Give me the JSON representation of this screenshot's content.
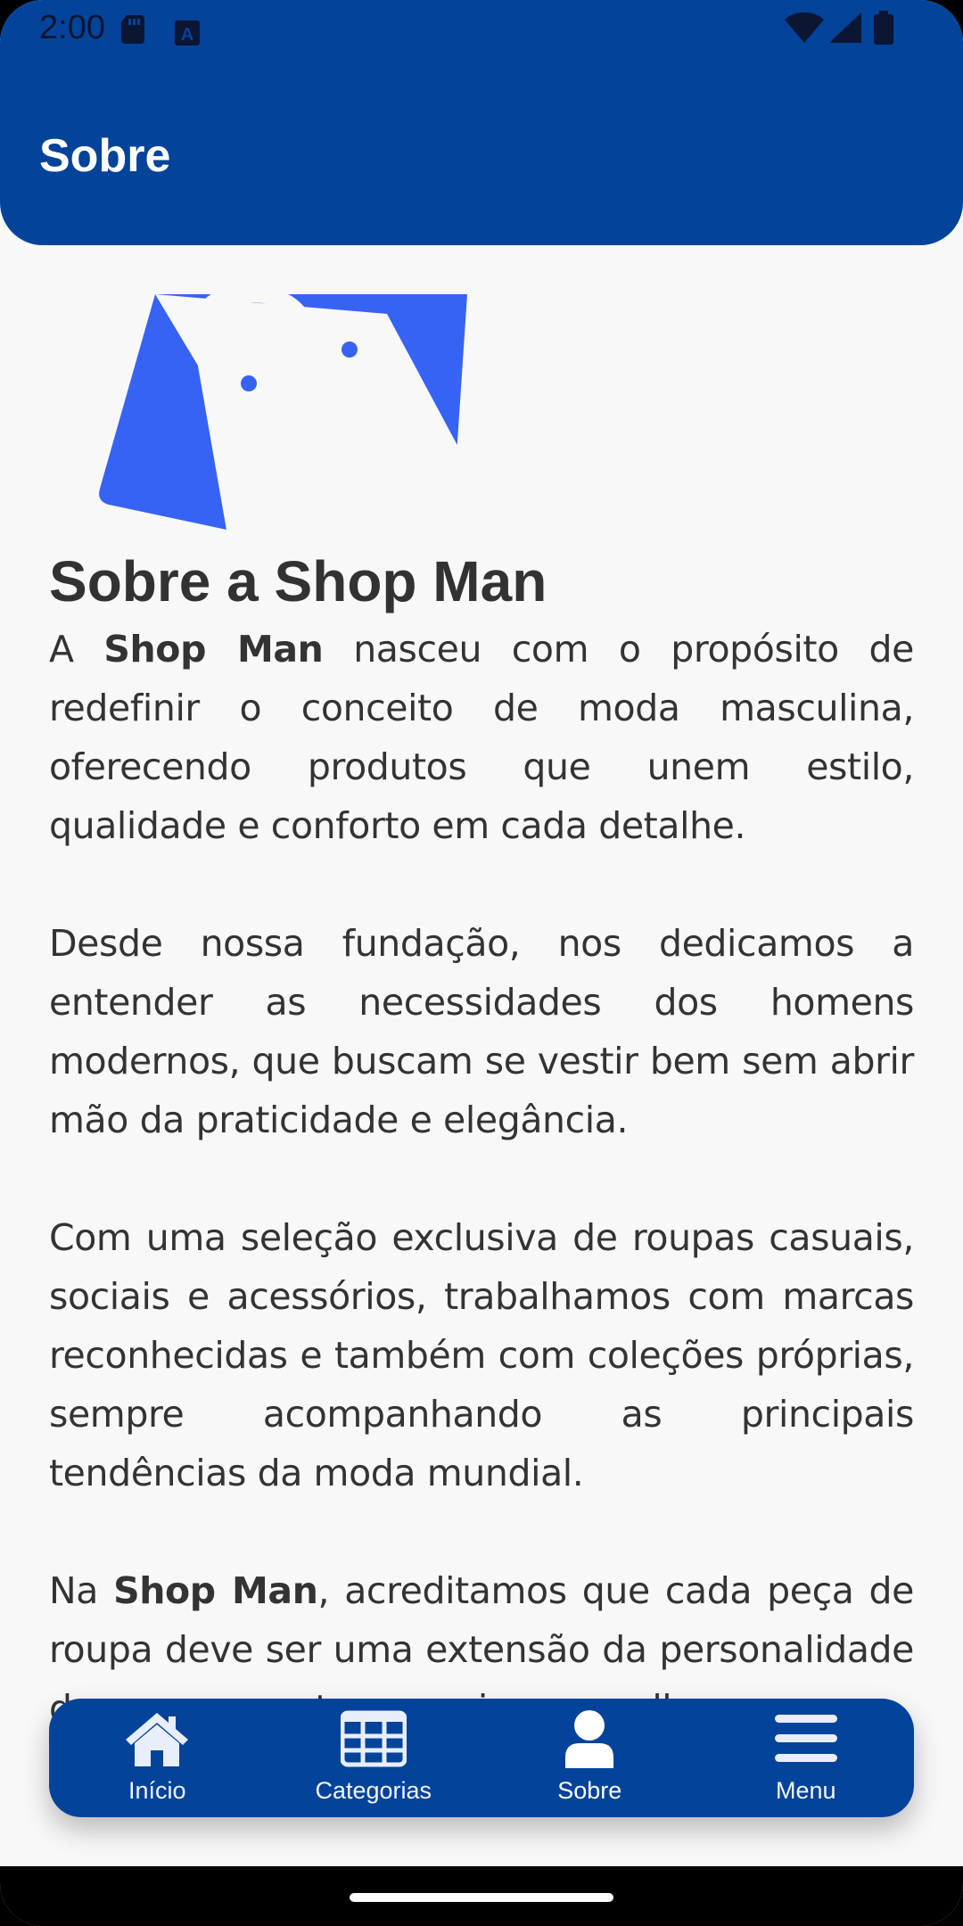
{
  "status_bar": {
    "time": "2:00"
  },
  "appbar": {
    "title": "Sobre"
  },
  "content": {
    "heading": "Sobre a Shop Man",
    "p1": {
      "pre": "A ",
      "bold": "Shop Man",
      "post": " nasceu com o propósito de redefinir o conceito de moda masculina, oferecendo produtos que unem estilo, qualidade e conforto em cada detalhe."
    },
    "p2": "Desde nossa fundação, nos dedicamos a entender as necessidades dos homens modernos, que buscam se vestir bem sem abrir mão da praticidade e elegância.",
    "p3": "Com uma seleção exclusiva de roupas casuais, sociais e acessórios, trabalhamos com marcas reconhecidas e também com coleções próprias, sempre acompanhando as principais tendências da moda mundial.",
    "p4": {
      "pre": "Na ",
      "bold": "Shop Man",
      "post": ", acreditamos que cada peça de roupa deve ser uma extensão da personalidade de quem a veste e, por isso, escolhemos com"
    }
  },
  "bottom_nav": {
    "items": [
      {
        "label": "Início",
        "icon": "home-icon"
      },
      {
        "label": "Categorias",
        "icon": "grid-icon"
      },
      {
        "label": "Sobre",
        "icon": "user-icon"
      },
      {
        "label": "Menu",
        "icon": "menu-icon"
      }
    ],
    "active_index": 2
  },
  "colors": {
    "primary": "#03439a",
    "logo": "#3763f4",
    "background": "#f8f8f9",
    "text": "#333333"
  }
}
